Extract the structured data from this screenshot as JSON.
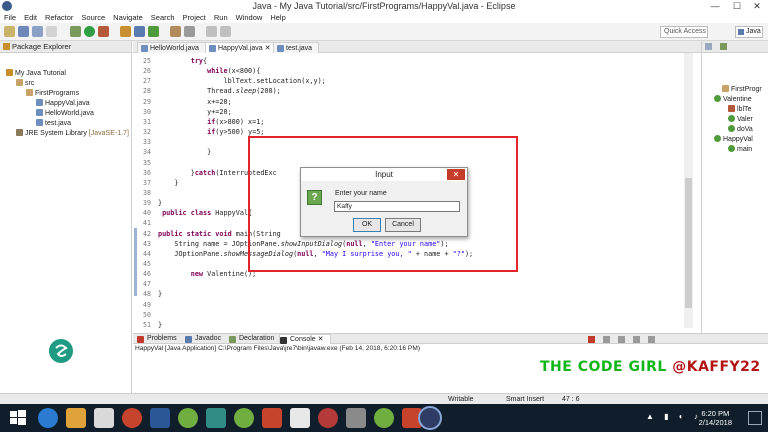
{
  "window": {
    "title": "Java - My Java Tutorial/src/FirstPrograms/HappyVal.java - Eclipse",
    "controls": [
      "—",
      "☐",
      "✕"
    ]
  },
  "menu": [
    "File",
    "Edit",
    "Refactor",
    "Source",
    "Navigate",
    "Search",
    "Project",
    "Run",
    "Window",
    "Help"
  ],
  "toolbar": {
    "quick_access": "Quick Access",
    "perspective": "Java"
  },
  "package_explorer": {
    "title": "Package Explorer",
    "other_tab": "Hierarchy",
    "tree": {
      "project": "My Java Tutorial",
      "src": "src",
      "package": "FirstPrograms",
      "files": [
        "HappyVal.java",
        "HelloWorld.java",
        "test.java"
      ],
      "jre": "JRE System Library",
      "jre_version": "[JavaSE-1.7]"
    }
  },
  "editor": {
    "tabs": [
      "HelloWorld.java",
      "HappyVal.java",
      "test.java"
    ],
    "lines": [
      {
        "n": "25",
        "html": "        <span class=\"kw\">try</span>{"
      },
      {
        "n": "26",
        "html": "            <span class=\"kw\">while</span>(x&lt;800){"
      },
      {
        "n": "27",
        "html": "                lblText.setLocation(x,y);"
      },
      {
        "n": "28",
        "html": "            Thread.<span class=\"ital\">sleep</span>(200);"
      },
      {
        "n": "29",
        "html": "            x+=20;"
      },
      {
        "n": "30",
        "html": "            y+=20;"
      },
      {
        "n": "31",
        "html": "            <span class=\"kw\">if</span>(x&gt;800) x=1;"
      },
      {
        "n": "32",
        "html": "            <span class=\"kw\">if</span>(y&gt;500) y=5;"
      },
      {
        "n": "33",
        "html": ""
      },
      {
        "n": "34",
        "html": "            }"
      },
      {
        "n": "35",
        "html": ""
      },
      {
        "n": "36",
        "html": "        }<span class=\"kw\">catch</span>(InterruptedExc                           <span class=\"str\">pted...\"</span>);"
      },
      {
        "n": "37",
        "html": "    }"
      },
      {
        "n": "38",
        "html": ""
      },
      {
        "n": "39",
        "html": "}"
      },
      {
        "n": "40",
        "html": " <span class=\"kw\">public class</span> HappyVal{"
      },
      {
        "n": "41",
        "html": ""
      },
      {
        "n": "42",
        "html": "<span class=\"kw\">public static void</span> main(String"
      },
      {
        "n": "43",
        "html": "    String name = JOptionPane.<span class=\"ital\">showInputDialog</span>(<span class=\"kw\">null</span>, <span class=\"str\">\"Enter your name\"</span>);"
      },
      {
        "n": "44",
        "html": "    JOptionPane.<span class=\"ital\">showMessageDialog</span>(<span class=\"kw\">null</span>, <span class=\"str\">\"May I surprise you, \"</span> + name + <span class=\"str\">\"?\"</span>);"
      },
      {
        "n": "45",
        "html": ""
      },
      {
        "n": "46",
        "html": "        <span class=\"kw\">new</span> Valentine();"
      },
      {
        "n": "47",
        "html": ""
      },
      {
        "n": "48",
        "html": "}"
      },
      {
        "n": "49",
        "html": ""
      },
      {
        "n": "50",
        "html": ""
      },
      {
        "n": "51",
        "html": "}"
      }
    ]
  },
  "outline": {
    "items": [
      "FirstProgr",
      "Valentine",
      "lblTe",
      "Valer",
      "doVa",
      "HappyVal",
      "main"
    ]
  },
  "bottom_tabs": [
    "Problems",
    "Javadoc",
    "Declaration",
    "Console"
  ],
  "console": {
    "line": "HappyVal [Java Application] C:\\Program Files\\Java\\jre7\\bin\\javaw.exe (Feb 14, 2018, 6:20:16 PM)"
  },
  "status": {
    "writable": "Writable",
    "insert_mode": "Smart Insert",
    "position": "47 : 6"
  },
  "dialog": {
    "title": "Input",
    "close": "✕",
    "icon": "?",
    "prompt": "Enter your name",
    "value": "Kaffy",
    "ok": "OK",
    "cancel": "Cancel"
  },
  "watermark": {
    "text": "THE CODE GIRL",
    "handle": "@KAFFY22"
  },
  "taskbar": {
    "time": "6:20 PM",
    "date": "2/14/2018"
  },
  "colors": {
    "highlight": "#e0262b",
    "brand": "#12b519"
  }
}
